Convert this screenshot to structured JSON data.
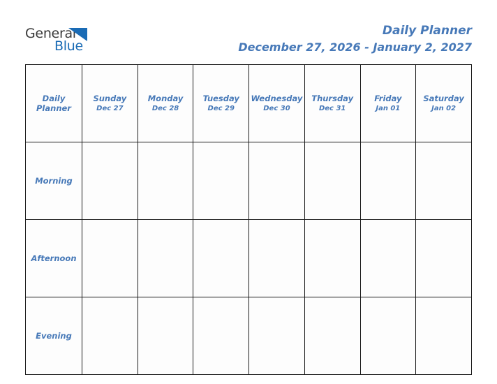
{
  "logo": {
    "word_dark": "General",
    "word_blue": "Blue",
    "triangle_color": "#1a6bb5",
    "dark_color": "#3a3a3a"
  },
  "header": {
    "title": "Daily Planner",
    "date_range": "December 27, 2026 - January 2, 2027",
    "title_color": "#4779b8"
  },
  "table": {
    "corner_label_line1": "Daily",
    "corner_label_line2": "Planner",
    "header_bg": "#dee7ce",
    "row_label_bg": "#e9e9e9",
    "cell_bg": "#fdfdfd",
    "border_color": "#1a1a1a",
    "columns": [
      {
        "day": "Sunday",
        "date": "Dec 27"
      },
      {
        "day": "Monday",
        "date": "Dec 28"
      },
      {
        "day": "Tuesday",
        "date": "Dec 29"
      },
      {
        "day": "Wednesday",
        "date": "Dec 30"
      },
      {
        "day": "Thursday",
        "date": "Dec 31"
      },
      {
        "day": "Friday",
        "date": "Jan 01"
      },
      {
        "day": "Saturday",
        "date": "Jan 02"
      }
    ],
    "rows": [
      {
        "label": "Morning",
        "cells": [
          "",
          "",
          "",
          "",
          "",
          "",
          ""
        ]
      },
      {
        "label": "Afternoon",
        "cells": [
          "",
          "",
          "",
          "",
          "",
          "",
          ""
        ]
      },
      {
        "label": "Evening",
        "cells": [
          "",
          "",
          "",
          "",
          "",
          "",
          ""
        ]
      }
    ]
  }
}
